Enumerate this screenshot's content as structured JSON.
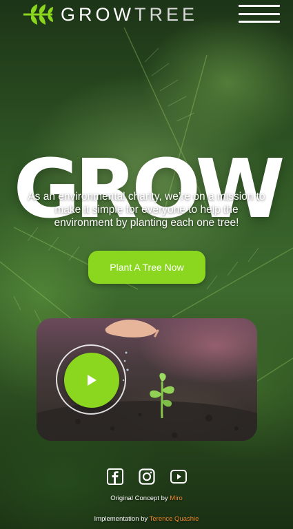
{
  "brand": {
    "name_grow": "GROW",
    "name_tree": "TREE",
    "accent": "#8bd61f"
  },
  "nav": {
    "menu_icon": "hamburger-icon"
  },
  "hero": {
    "title": "GROW",
    "description": "As an environmental charity, we’re on a mission to make it simple for everyone to help the environment by planting each one tree!",
    "cta_label": "Plant A Tree Now"
  },
  "video": {
    "play_icon": "play-icon"
  },
  "socials": [
    "facebook-icon",
    "instagram-icon",
    "youtube-icon"
  ],
  "footer": {
    "concept_prefix": "Original Concept by",
    "concept_link": "Miro",
    "impl_prefix": "Implementation by",
    "impl_link": "Terence Quashie",
    "link_color": "#f08a2a"
  }
}
